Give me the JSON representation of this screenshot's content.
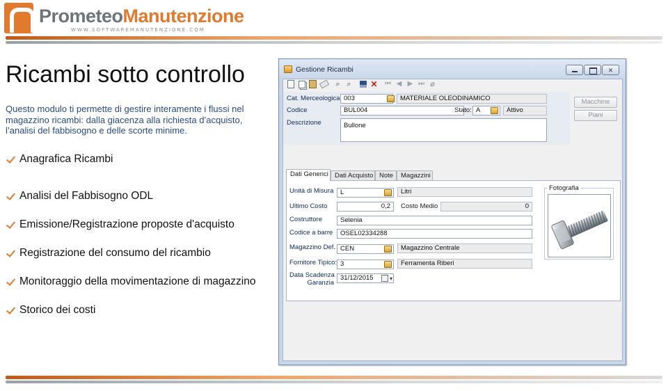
{
  "brand": {
    "name_part1": "Prometeo",
    "name_part2": "Manutenzione",
    "website": "WWW.SOFTWAREMANUTENZIONE.COM"
  },
  "slide": {
    "title": "Ricambi sotto controllo",
    "description": "Questo modulo ti permette di gestire interamente i flussi nel magazzino ricambi: dalla giacenza alla richiesta d’acquisto, l’analisi del fabbisogno e delle scorte minime.",
    "bullets": [
      "Anagrafica Ricambi",
      "Analisi del Fabbisogno ODL",
      "Emissione/Registrazione proposte d'acquisto",
      "Registrazione del consumo del ricambio",
      "Monitoraggio della movimentazione di magazzino",
      "Storico dei costi"
    ]
  },
  "window": {
    "title": "Gestione Ricambi"
  },
  "header": {
    "cat_label": "Cat. Merceologica",
    "cat_code": "003",
    "cat_desc": "MATERIALE OLEODINAMICO",
    "code_label": "Codice",
    "code_value": "BUL004",
    "state_label": "Stato:",
    "state_code": "A",
    "state_desc": "Attivo",
    "desc_label": "Descrizione",
    "desc_value": "Bullone",
    "btn_macchine": "Macchine",
    "btn_piani": "Piani"
  },
  "tabs": [
    "Dati Generici",
    "Dati Acquisto",
    "Note",
    "Magazzini"
  ],
  "general": {
    "um_label": "Unità di Misura",
    "um_code": "L",
    "um_desc": "Litri",
    "last_cost_label": "Ultimo Costo",
    "last_cost": "0,2",
    "avg_cost_label": "Costo Medio",
    "avg_cost": "0",
    "manufacturer_label": "Costruttore",
    "manufacturer": "Selenia",
    "barcode_label": "Codice a barre",
    "barcode": "OSEL02334288",
    "warehouse_label": "Magazzino Def.",
    "warehouse_code": "CEN",
    "warehouse_desc": "Magazzino Centrale",
    "supplier_label": "Fornitore Tipico:",
    "supplier_code": "3",
    "supplier_desc": "Ferramenta Riberi",
    "warranty_label_1": "Data Scadenza",
    "warranty_label_2": "Garanzia",
    "warranty_date": "31/12/2015",
    "photo_label": "Fotografia"
  },
  "colors": {
    "brand_orange": "#e07a2e",
    "brand_gray": "#6f7478",
    "label_blue": "#0f2a5c",
    "desc_blue": "#2a4a8a"
  }
}
